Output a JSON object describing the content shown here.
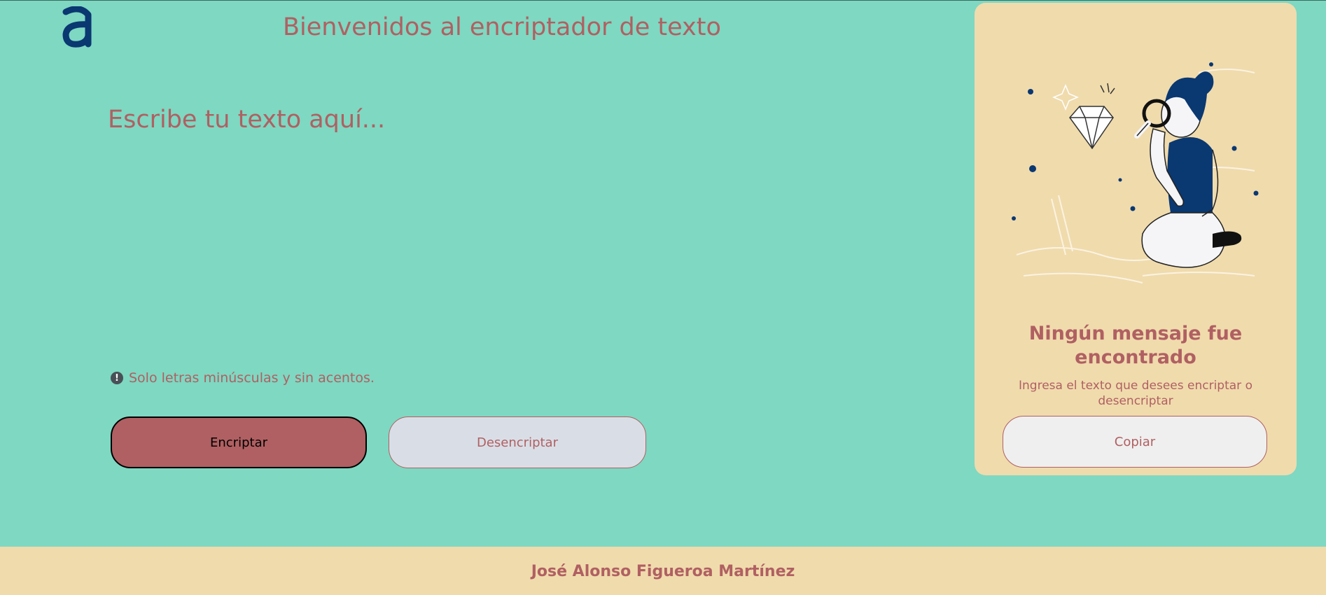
{
  "header": {
    "logo_icon": "alura-a-logo-icon",
    "title": "Bienvenidos al encriptador de texto"
  },
  "main": {
    "input_placeholder": "Escribe tu texto aquí...",
    "hint_icon": "exclamation-circle-icon",
    "hint_text": "Solo letras minúsculas y sin acentos.",
    "encrypt_label": "Encriptar",
    "decrypt_label": "Desencriptar"
  },
  "panel": {
    "illustration": "person-with-magnifier-inspecting-diamond",
    "title": "Ningún mensaje fue encontrado",
    "subtitle": "Ingresa el texto que desees encriptar o desencriptar",
    "copy_label": "Copiar"
  },
  "footer": {
    "author": "José Alonso Figueroa Martínez"
  },
  "colors": {
    "background": "#7ed8c2",
    "accent_text": "#b06062",
    "panel": "#f0dbad",
    "logo": "#0a3871",
    "decrypt_button": "#d9dee6"
  }
}
